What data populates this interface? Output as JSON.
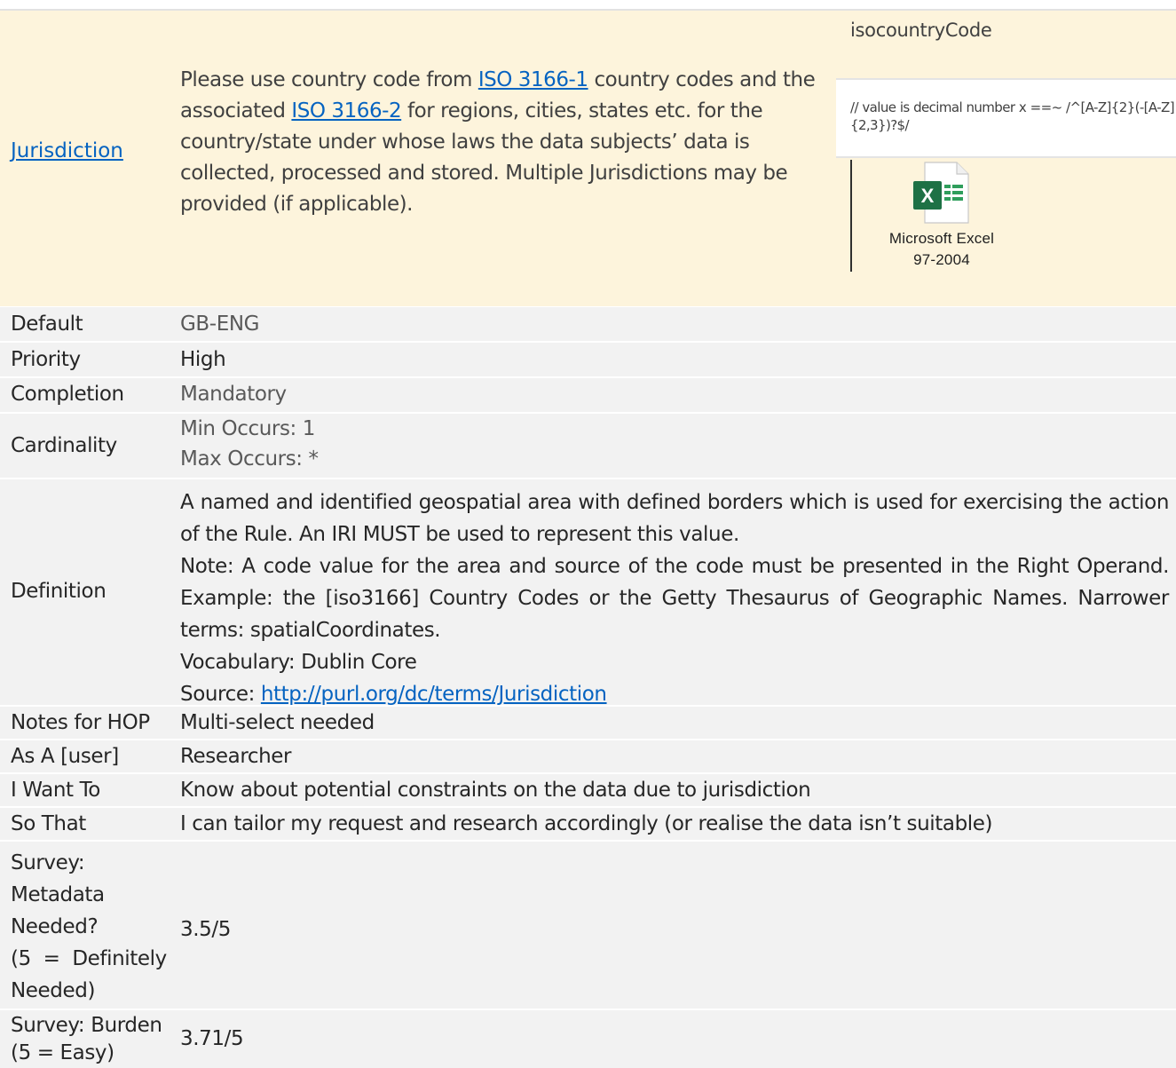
{
  "header": {
    "title": "Jurisdiction",
    "intro": {
      "part1": " Please use country code from ",
      "link1": "ISO 3166-1",
      "part2": " country codes and the associated ",
      "link2": "ISO 3166-2",
      "part3": " for regions, cities, states etc. for the country/state under whose laws the data subjects’ data is collected, processed and stored. Multiple Jurisdictions may be provided (if applicable)."
    },
    "field_name": "isocountryCode",
    "regex": "// value is decimal number x ==~ /^[A-Z]{2}(-[A-Z]{2,3})?$/",
    "attachment": {
      "icon": "excel-icon",
      "label_line1": "Microsoft Excel",
      "label_line2": "97-2004",
      "green": "#1e7145"
    }
  },
  "rows": {
    "default": {
      "label": "Default",
      "value": "GB-ENG"
    },
    "priority": {
      "label": "Priority",
      "value": "High"
    },
    "completion": {
      "label": "Completion",
      "value": "Mandatory"
    },
    "cardinality": {
      "label": "Cardinality",
      "min": "Min Occurs: 1",
      "max": "Max Occurs: *"
    },
    "definition": {
      "label": "Definition",
      "line1": "A named and identified geospatial area with defined borders which is used for exercising the action of the Rule. An IRI MUST be used to represent this value.",
      "line2": "Note: A code value for the area and source of the code must be presented in the Right Operand. Example: the [iso3166] Country Codes or the Getty Thesaurus of Geographic Names. Narrower terms: spatialCoordinates.",
      "line3": "Vocabulary: Dublin Core",
      "source_label": "Source: ",
      "source_link": "http://purl.org/dc/terms/Jurisdiction"
    },
    "notes": {
      "label": "Notes for HOP",
      "value": "Multi-select needed"
    },
    "as_a": {
      "label": "As A [user]",
      "value": "Researcher"
    },
    "i_want": {
      "label": "I Want To",
      "value": "Know about potential constraints on the data due to jurisdiction"
    },
    "so_that": {
      "label": "So That",
      "value": "I can tailor my request and research accordingly (or realise the data isn’t suitable)"
    },
    "survey_needed": {
      "label_lines": [
        "Survey:",
        "Metadata",
        "Needed?",
        "(5  =  Definitely",
        "Needed)"
      ],
      "value": "3.5/5"
    },
    "survey_burden": {
      "label_lines": [
        "Survey: Burden",
        "(5 = Easy)"
      ],
      "value": "3.71/5"
    }
  }
}
